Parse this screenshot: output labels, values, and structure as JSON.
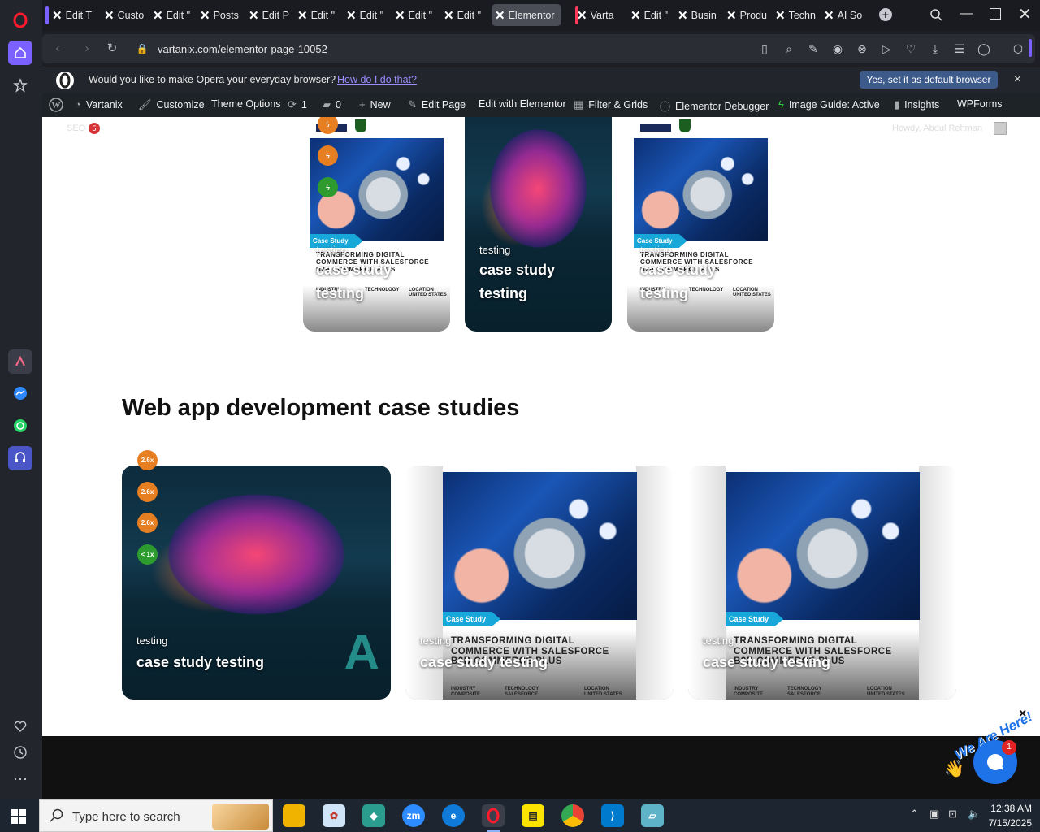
{
  "browser": {
    "tabs": [
      {
        "label": "Edit T",
        "active": false
      },
      {
        "label": "Custo",
        "active": false
      },
      {
        "label": "Edit \"",
        "active": false
      },
      {
        "label": "Posts",
        "active": false
      },
      {
        "label": "Edit P",
        "active": false
      },
      {
        "label": "Edit \"",
        "active": false
      },
      {
        "label": "Edit \"",
        "active": false
      },
      {
        "label": "Edit \"",
        "active": false
      },
      {
        "label": "Edit \"",
        "active": false
      },
      {
        "label": "Elementor",
        "active": true
      },
      {
        "label": "Varta",
        "active": false
      },
      {
        "label": "Edit \"",
        "active": false
      },
      {
        "label": "Busin",
        "active": false
      },
      {
        "label": "Produ",
        "active": false
      },
      {
        "label": "Techn",
        "active": false
      },
      {
        "label": "AI So",
        "active": false
      }
    ],
    "url": "vartanix.com/elementor-page-10052",
    "colors": {
      "accent": "#7b61ff",
      "opera_red": "#ff1b2d"
    }
  },
  "notification": {
    "message": "Would you like to make Opera your everyday browser?",
    "link": "How do I do that?",
    "button": "Yes, set it as default browser",
    "close": "×"
  },
  "wpbar": {
    "site": "Vartanix",
    "customize": "Customize",
    "theme_options": "Theme Options",
    "updates": "1",
    "comments": "0",
    "new": "New",
    "edit_page": "Edit Page",
    "edit_elementor": "Edit with Elementor",
    "filter_grids": "Filter & Grids",
    "debugger": "Elementor Debugger",
    "image_guide": "Image Guide: Active",
    "insights": "Insights",
    "wpforms": "WPForms"
  },
  "page": {
    "seo_label": "SEO",
    "seo_count": "5",
    "howdy": "Howdy, Abdul Rehman",
    "top_cards": [
      {
        "label": "testing",
        "title_line1": "case study",
        "title_line2": "testing",
        "doc_title": "TRANSFORMING DIGITAL COMMERCE WITH SALESFORCE B2B COMMERCE PLUS",
        "tag": "Case Study",
        "meta": [
          "INDUSTRY",
          "TECHNOLOGY",
          "LOCATION",
          "UNITED STATES"
        ],
        "pills": [
          "ϟ",
          "ϟ",
          "ϟ"
        ]
      },
      {
        "label": "testing",
        "title_line1": "case study",
        "title_line2": "testing"
      },
      {
        "label": "testing",
        "title_line1": "case study",
        "title_line2": "testing",
        "doc_title": "TRANSFORMING DIGITAL COMMERCE WITH SALESFORCE B2B COMMERCE PLUS",
        "tag": "Case Study",
        "meta": [
          "INDUSTRY",
          "TECHNOLOGY",
          "LOCATION",
          "UNITED STATES"
        ]
      }
    ],
    "section_heading": "Web app development case studies",
    "cards": [
      {
        "label": "testing",
        "title": "case study testing",
        "pills": [
          "2.6x",
          "2.6x",
          "2.6x",
          "< 1x"
        ]
      },
      {
        "label": "testing",
        "title": "case study testing",
        "tag": "Case Study",
        "doc_title": "TRANSFORMING DIGITAL COMMERCE WITH SALESFORCE B2B COMMERCE PLUS",
        "meta": [
          "INDUSTRY",
          "COMPOSITE",
          "TECHNOLOGY",
          "SALESFORCE",
          "LOCATION",
          "UNITED STATES"
        ]
      },
      {
        "label": "testing",
        "title": "case study testing",
        "tag": "Case Study",
        "doc_title": "TRANSFORMING DIGITAL COMMERCE WITH SALESFORCE B2B COMMERCE PLUS",
        "meta": [
          "INDUSTRY",
          "COMPOSITE",
          "TECHNOLOGY",
          "SALESFORCE",
          "LOCATION",
          "UNITED STATES"
        ]
      }
    ],
    "chat": {
      "label": "We Are Here!",
      "badge": "1",
      "close": "×"
    }
  },
  "taskbar": {
    "search_placeholder": "Type here to search",
    "time": "12:38 AM",
    "date": "7/15/2025"
  }
}
